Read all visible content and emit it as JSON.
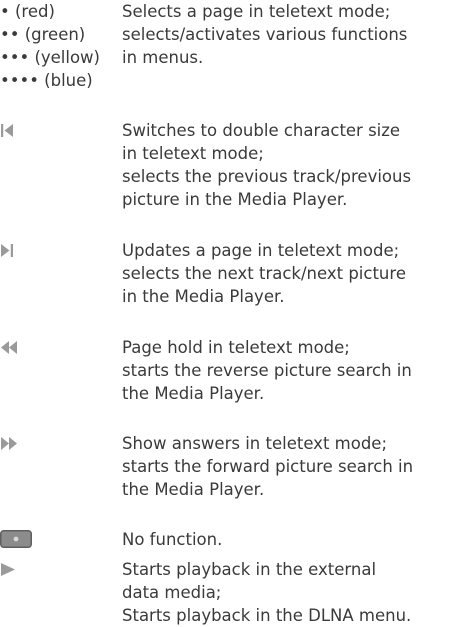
{
  "colors": {
    "text": "#3a3a3a",
    "symbol": "#9a9a9a",
    "button_fill": "#8c8c8c",
    "button_border": "#5f5f5f",
    "button_dot": "#d8d8d8"
  },
  "color_keys": {
    "red_label": "• (red)",
    "green_label": "•• (green)",
    "yellow_label": "••• (yellow)",
    "blue_label": "•••• (blue)",
    "desc": [
      "Selects a page in teletext mode;",
      "selects/activates various functions",
      "in menus."
    ]
  },
  "entries": [
    {
      "icon": "skip-back-icon",
      "lines": [
        "Switches to double character size",
        "in teletext mode;",
        "selects the previous track/previous",
        "picture in the Media Player."
      ]
    },
    {
      "icon": "skip-forward-icon",
      "lines": [
        "Updates a page in teletext mode;",
        "selects the next track/next picture",
        "in the Media Player."
      ]
    },
    {
      "icon": "rewind-icon",
      "lines": [
        "Page hold in teletext mode;",
        "starts the reverse picture search in",
        "the Media Player."
      ]
    },
    {
      "icon": "fast-forward-icon",
      "lines": [
        "Show answers in teletext mode;",
        "starts the forward picture search in",
        "the Media Player."
      ]
    },
    {
      "icon": "record-button-icon",
      "lines": [
        "No function."
      ]
    },
    {
      "icon": "play-icon",
      "lines": [
        "Starts playback in the external",
        "data media;",
        "Starts playback in the DLNA menu."
      ]
    }
  ]
}
